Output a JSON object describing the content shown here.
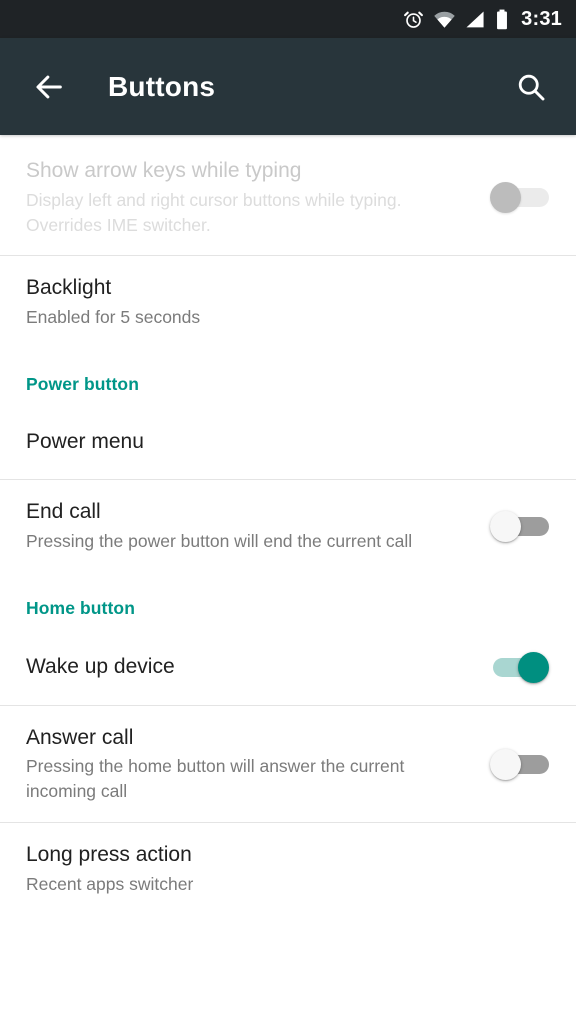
{
  "status_bar": {
    "background": "#1f2326",
    "time": "3:31",
    "icons": [
      "alarm-icon",
      "wifi-icon",
      "cellular-signal-icon",
      "battery-icon"
    ]
  },
  "app_bar": {
    "background": "#28353b",
    "title": "Buttons",
    "back_icon": "back-arrow-icon",
    "search_icon": "search-icon"
  },
  "theme": {
    "accent": "#009688",
    "title_color": "#212121",
    "summary_color": "#7b7b7b",
    "divider": "#e4e4e4"
  },
  "preferences": [
    {
      "key": "show_arrow_keys",
      "title": "Show arrow keys while typing",
      "summary": "Display left and right cursor buttons while typing. Overrides IME switcher.",
      "control": "switch",
      "checked": false,
      "enabled": false
    },
    {
      "key": "backlight",
      "title": "Backlight",
      "summary": "Enabled for 5 seconds",
      "control": "none",
      "enabled": true
    },
    {
      "key": "power_button_header",
      "title": "Power button",
      "control": "section-header"
    },
    {
      "key": "power_menu",
      "title": "Power menu",
      "summary": "",
      "control": "none",
      "enabled": true
    },
    {
      "key": "end_call",
      "title": "End call",
      "summary": "Pressing the power button will end the current call",
      "control": "switch",
      "checked": false,
      "enabled": true
    },
    {
      "key": "home_button_header",
      "title": "Home button",
      "control": "section-header"
    },
    {
      "key": "wake_up_device",
      "title": "Wake up device",
      "summary": "",
      "control": "switch",
      "checked": true,
      "enabled": true
    },
    {
      "key": "answer_call",
      "title": "Answer call",
      "summary": "Pressing the home button will answer the current incoming call",
      "control": "switch",
      "checked": false,
      "enabled": true
    },
    {
      "key": "long_press_action",
      "title": "Long press action",
      "summary": "Recent apps switcher",
      "control": "none",
      "enabled": true
    }
  ]
}
